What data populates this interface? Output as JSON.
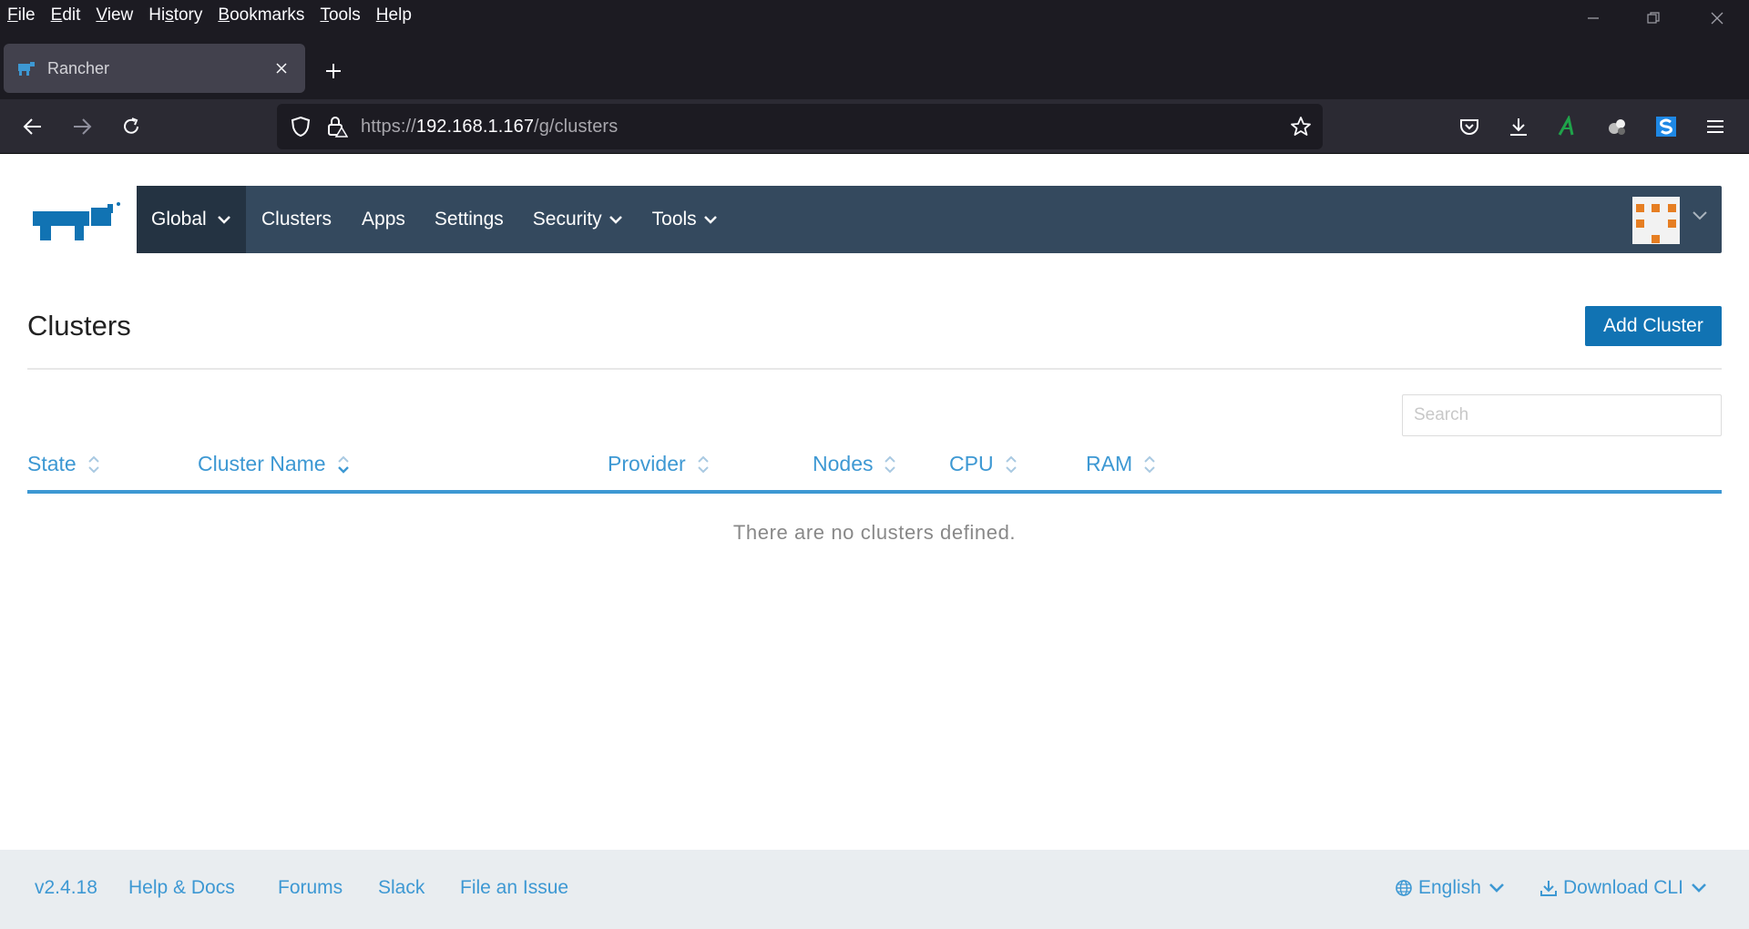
{
  "browser": {
    "menu": [
      {
        "pre": "",
        "ul": "F",
        "post": "ile"
      },
      {
        "pre": "",
        "ul": "E",
        "post": "dit"
      },
      {
        "pre": "",
        "ul": "V",
        "post": "iew"
      },
      {
        "pre": "Hi",
        "ul": "s",
        "post": "tory"
      },
      {
        "pre": "",
        "ul": "B",
        "post": "ookmarks"
      },
      {
        "pre": "",
        "ul": "T",
        "post": "ools"
      },
      {
        "pre": "",
        "ul": "H",
        "post": "elp"
      }
    ],
    "tab": {
      "title": "Rancher"
    },
    "url": {
      "scheme": "https://",
      "host": "192.168.1.167",
      "path": "/g/clusters"
    }
  },
  "app": {
    "nav": {
      "global": "Global",
      "items": [
        "Clusters",
        "Apps",
        "Settings",
        "Security",
        "Tools"
      ]
    },
    "page": {
      "title": "Clusters",
      "add_button": "Add Cluster",
      "search_placeholder": "Search"
    },
    "table": {
      "columns": [
        "State",
        "Cluster Name",
        "Provider",
        "Nodes",
        "CPU",
        "RAM"
      ],
      "empty_message": "There are no clusters defined."
    },
    "footer": {
      "version": "v2.4.18",
      "links": [
        "Help & Docs",
        "Forums",
        "Slack",
        "File an Issue"
      ],
      "language": "English",
      "download": "Download CLI"
    }
  },
  "colors": {
    "nav_bg": "#34495e",
    "nav_active_bg": "#243342",
    "primary_button": "#1173b3",
    "link_blue": "#3d98d3",
    "footer_bg": "#e9edf0"
  }
}
